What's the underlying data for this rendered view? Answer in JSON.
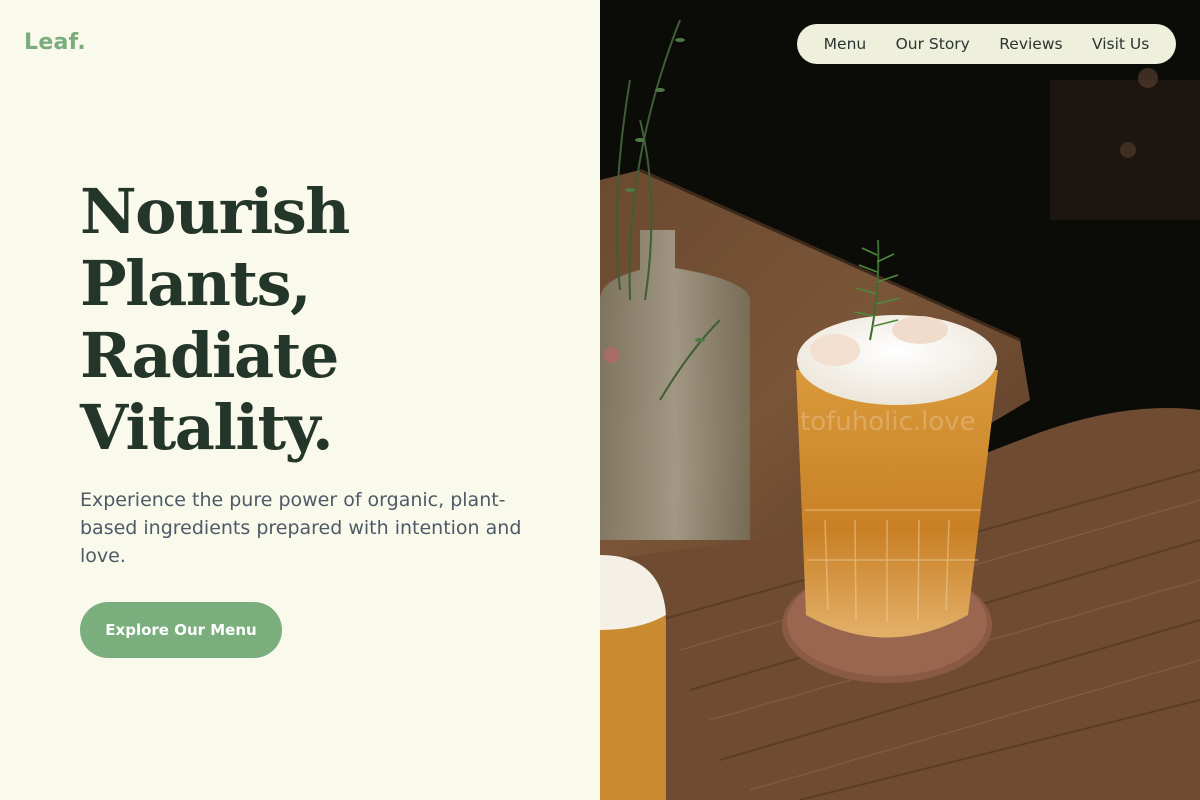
{
  "brand": {
    "logo": "Leaf."
  },
  "nav": {
    "items": [
      {
        "label": "Menu"
      },
      {
        "label": "Our Story"
      },
      {
        "label": "Reviews"
      },
      {
        "label": "Visit Us"
      }
    ]
  },
  "hero": {
    "headline_lines": [
      "Nourish",
      "Plants,",
      "Radiate",
      "Vitality."
    ],
    "subtext": "Experience the pure power of organic, plant-based ingredients prepared with intention and love.",
    "cta_label": "Explore Our Menu"
  },
  "photo": {
    "description_icon": "drink-photo",
    "watermark": "tofuholic.love"
  },
  "colors": {
    "background": "#f9f9ec",
    "accent": "#7aae7d",
    "heading": "#24362a",
    "body_text": "#4e5a66",
    "nav_bg": "#eef0dc"
  }
}
